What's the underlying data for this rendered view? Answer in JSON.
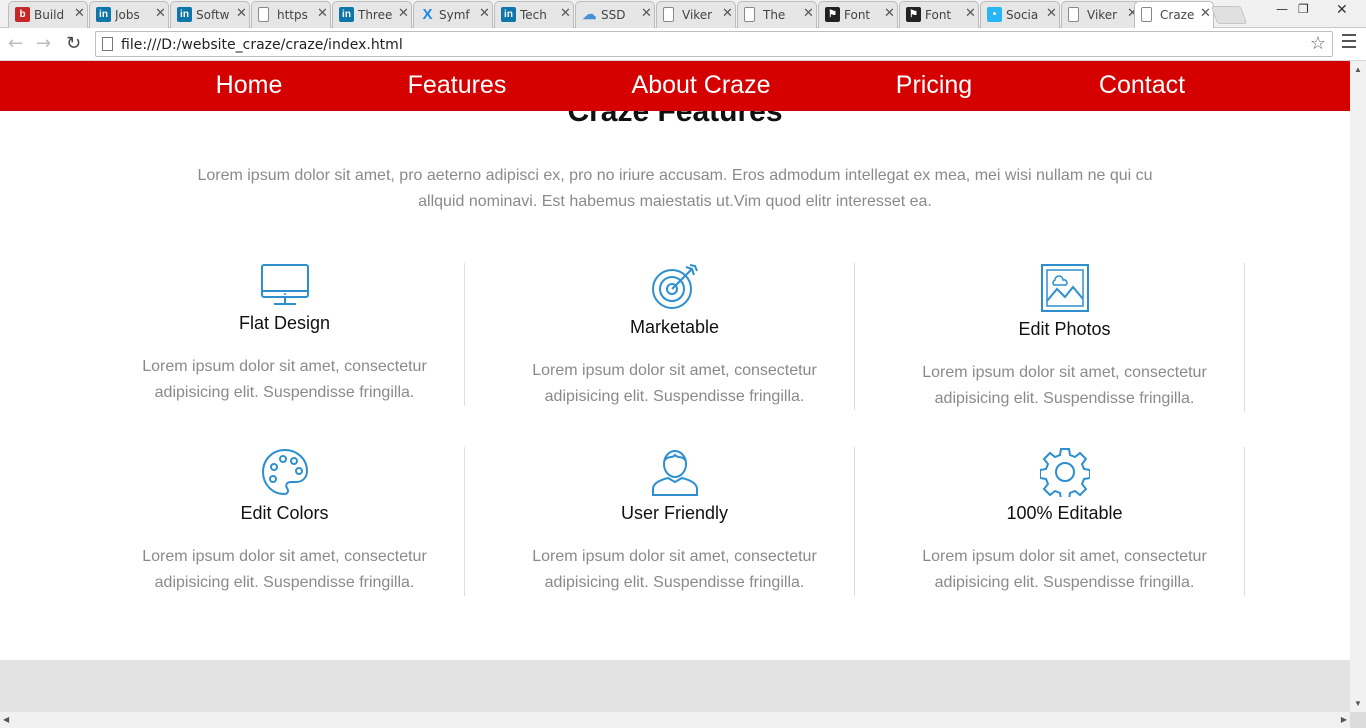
{
  "browser": {
    "tabs": [
      {
        "title": "Build",
        "icon": "builtwith-icon",
        "color": "#c62828"
      },
      {
        "title": "Jobs",
        "icon": "linkedin-icon",
        "color": "#0e76a8"
      },
      {
        "title": "Softw",
        "icon": "linkedin-icon",
        "color": "#0e76a8"
      },
      {
        "title": "https",
        "icon": "page-icon",
        "color": ""
      },
      {
        "title": "Three",
        "icon": "linkedin-icon",
        "color": "#0e76a8"
      },
      {
        "title": "Symf",
        "icon": "symfony-icon",
        "color": "#1e88e5"
      },
      {
        "title": "Tech",
        "icon": "linkedin-icon",
        "color": "#0e76a8"
      },
      {
        "title": "SSD",
        "icon": "cloud-icon",
        "color": "#4a90d9"
      },
      {
        "title": "Viker",
        "icon": "page-icon",
        "color": ""
      },
      {
        "title": "The",
        "icon": "page-icon",
        "color": ""
      },
      {
        "title": "Font",
        "icon": "flag-icon",
        "color": "#222222"
      },
      {
        "title": "Font",
        "icon": "flag-icon",
        "color": "#222222"
      },
      {
        "title": "Socia",
        "icon": "social-icon",
        "color": "#29b6f6"
      },
      {
        "title": "Viker",
        "icon": "page-icon",
        "color": ""
      },
      {
        "title": "Craze",
        "icon": "page-icon",
        "color": "",
        "active": true
      }
    ],
    "url": "file:///D:/website_craze/craze/index.html"
  },
  "site": {
    "accent": "#d50000",
    "icon_color": "#2d8fd0",
    "nav": [
      "Home",
      "Features",
      "About Craze",
      "Pricing",
      "Contact"
    ],
    "section_title": "Craze Features",
    "intro": "Lorem ipsum dolor sit amet, pro aeterno adipisci ex, pro no iriure accusam. Eros admodum intellegat ex mea, mei wisi nullam ne qui cu allquid nominavi. Est habemus maiestatis ut.Vim quod elitr interesset ea.",
    "features": [
      {
        "title": "Flat Design",
        "icon": "monitor-icon",
        "desc": "Lorem ipsum dolor sit amet, consectetur adipisicing elit. Suspendisse fringilla."
      },
      {
        "title": "Marketable",
        "icon": "target-icon",
        "desc": "Lorem ipsum dolor sit amet, consectetur adipisicing elit. Suspendisse fringilla."
      },
      {
        "title": "Edit Photos",
        "icon": "photo-icon",
        "desc": "Lorem ipsum dolor sit amet, consectetur adipisicing elit. Suspendisse fringilla."
      },
      {
        "title": "Edit Colors",
        "icon": "palette-icon",
        "desc": "Lorem ipsum dolor sit amet, consectetur adipisicing elit. Suspendisse fringilla."
      },
      {
        "title": "User Friendly",
        "icon": "user-icon",
        "desc": "Lorem ipsum dolor sit amet, consectetur adipisicing elit. Suspendisse fringilla."
      },
      {
        "title": "100% Editable",
        "icon": "gear-icon",
        "desc": "Lorem ipsum dolor sit amet, consectetur adipisicing elit. Suspendisse fringilla."
      }
    ]
  }
}
